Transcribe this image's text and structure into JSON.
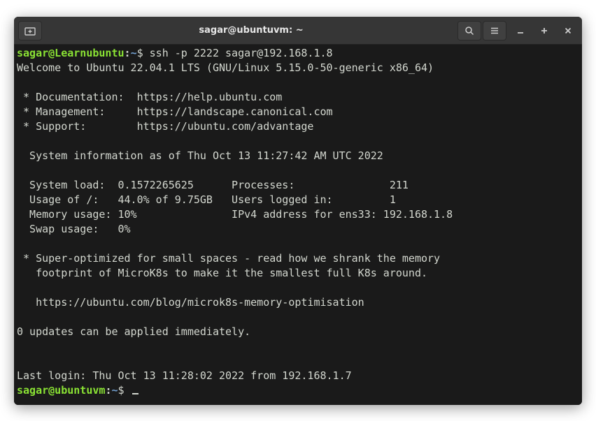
{
  "window": {
    "title": "sagar@ubuntuvm: ~"
  },
  "prompt1": {
    "user_host": "sagar@Learnubuntu",
    "colon": ":",
    "path": "~",
    "dollar": "$ ",
    "command": "ssh -p 2222 sagar@192.168.1.8"
  },
  "motd": {
    "welcome": "Welcome to Ubuntu 22.04.1 LTS (GNU/Linux 5.15.0-50-generic x86_64)",
    "blank1": "",
    "doc": " * Documentation:  https://help.ubuntu.com",
    "mgmt": " * Management:     https://landscape.canonical.com",
    "support": " * Support:        https://ubuntu.com/advantage",
    "blank2": "",
    "sysinfo_hdr": "  System information as of Thu Oct 13 11:27:42 AM UTC 2022",
    "blank3": "",
    "row1": "  System load:  0.1572265625      Processes:               211",
    "row2": "  Usage of /:   44.0% of 9.75GB   Users logged in:         1",
    "row3": "  Memory usage: 10%               IPv4 address for ens33: 192.168.1.8",
    "row4": "  Swap usage:   0%",
    "blank4": "",
    "micro1": " * Super-optimized for small spaces - read how we shrank the memory",
    "micro2": "   footprint of MicroK8s to make it the smallest full K8s around.",
    "blank5": "",
    "micro3": "   https://ubuntu.com/blog/microk8s-memory-optimisation",
    "blank6": "",
    "updates": "0 updates can be applied immediately.",
    "blank7": "",
    "blank8": "",
    "lastlogin": "Last login: Thu Oct 13 11:28:02 2022 from 192.168.1.7"
  },
  "prompt2": {
    "user_host": "sagar@ubuntuvm",
    "colon": ":",
    "path": "~",
    "dollar": "$ "
  }
}
